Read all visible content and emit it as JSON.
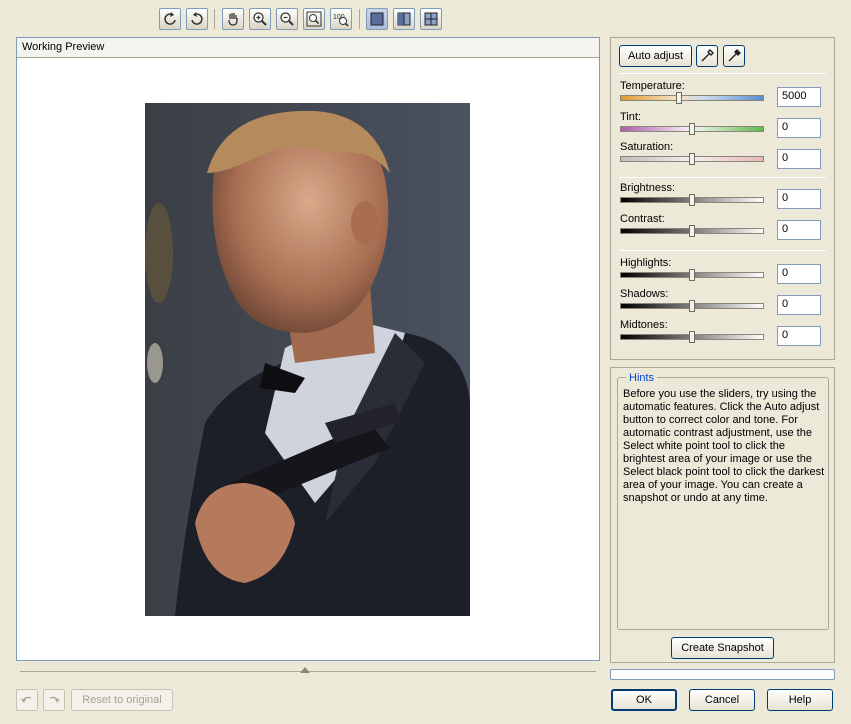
{
  "preview": {
    "title": "Working Preview"
  },
  "toolbar": {
    "buttons": [
      {
        "name": "rotate-left",
        "icon": "rotate-left-icon"
      },
      {
        "name": "rotate-right",
        "icon": "rotate-right-icon"
      },
      {
        "name": "pan",
        "icon": "hand-icon"
      },
      {
        "name": "zoom-in",
        "icon": "zoom-in-icon"
      },
      {
        "name": "zoom-out",
        "icon": "zoom-out-icon"
      },
      {
        "name": "zoom-fit",
        "icon": "zoom-fit-icon"
      },
      {
        "name": "zoom-100",
        "icon": "zoom-100-icon",
        "text": "100"
      },
      {
        "name": "single-view",
        "icon": "single-view-icon"
      },
      {
        "name": "split-view",
        "icon": "split-view-icon"
      },
      {
        "name": "quad-view",
        "icon": "quad-view-icon"
      }
    ]
  },
  "adjust": {
    "auto_adjust_label": "Auto adjust",
    "sliders": [
      {
        "label": "Temperature:",
        "value": "5000",
        "position": 0.41
      },
      {
        "label": "Tint:",
        "value": "0",
        "position": 0.5
      },
      {
        "label": "Saturation:",
        "value": "0",
        "position": 0.5
      },
      {
        "label": "Brightness:",
        "value": "0",
        "position": 0.5
      },
      {
        "label": "Contrast:",
        "value": "0",
        "position": 0.5
      },
      {
        "label": "Highlights:",
        "value": "0",
        "position": 0.5
      },
      {
        "label": "Shadows:",
        "value": "0",
        "position": 0.5
      },
      {
        "label": "Midtones:",
        "value": "0",
        "position": 0.5
      }
    ]
  },
  "hints": {
    "title": "Hints",
    "text": "Before you use the sliders, try using the automatic features. Click the Auto adjust button to correct color and tone. For automatic contrast adjustment, use the Select white point tool to click the brightest area of your image or use the Select black point tool to click the darkest area of your image. You can create a snapshot or undo at any time."
  },
  "buttons": {
    "create_snapshot": "Create Snapshot",
    "reset": "Reset to original",
    "ok": "OK",
    "cancel": "Cancel",
    "help": "Help"
  }
}
